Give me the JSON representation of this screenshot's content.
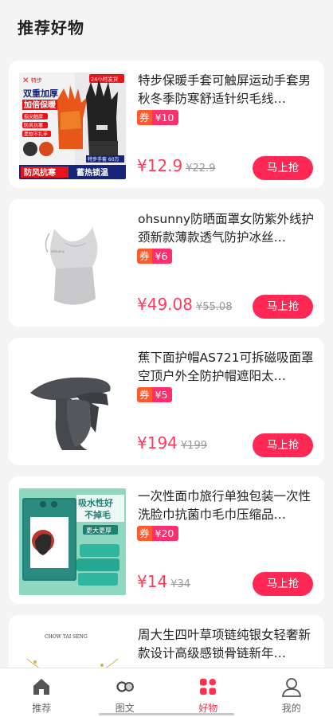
{
  "header": {
    "title": "推荐好物"
  },
  "products": [
    {
      "title": "特步保暖手套可触屏运动手套男秋冬季防寒舒适针织毛线…",
      "coupon_tag": "券",
      "coupon_value": "¥10",
      "price": "¥12.9",
      "original_price": "¥22.9",
      "buy_label": "马上抢",
      "image_text": {
        "brand": "特步",
        "badge": "24小时发货",
        "headline1": "双重加厚",
        "headline2": "加倍保暖",
        "feature1": "指尖触屏",
        "feature2": "防风抗寒",
        "feature3": "柔软不扎手",
        "sales": "特步手套 60万",
        "tag1": "防风抗寒",
        "tag2": "蓄热锁温"
      }
    },
    {
      "title": "ohsunny防晒面罩女防紫外线护颈新款薄款透气防护冰丝…",
      "coupon_tag": "券",
      "coupon_value": "¥6",
      "price": "¥49.08",
      "original_price": "¥55.08",
      "buy_label": "马上抢"
    },
    {
      "title": "蕉下面护帽AS721可拆磁吸面罩空顶户外全防护帽遮阳太…",
      "coupon_tag": "券",
      "coupon_value": "¥5",
      "price": "¥194",
      "original_price": "¥199",
      "buy_label": "马上抢"
    },
    {
      "title": "一次性面巾旅行单独包装一次性洗脸巾抗菌巾毛巾压缩品…",
      "coupon_tag": "券",
      "coupon_value": "¥20",
      "price": "¥14",
      "original_price": "¥34",
      "buy_label": "马上抢",
      "image_text": {
        "line1": "吸水性好",
        "line2": "不掉毛",
        "line3": "更大更厚"
      }
    },
    {
      "title": "周大生四叶草项链纯银女轻奢新款设计高级感锁骨链新年…",
      "image_text": {
        "brand": "CHOW TAI SENG"
      }
    }
  ],
  "tabbar": {
    "items": [
      {
        "label": "推荐",
        "icon": "home-icon"
      },
      {
        "label": "图文",
        "icon": "image-text-icon"
      },
      {
        "label": "好物",
        "icon": "goods-grid-icon",
        "active": true
      },
      {
        "label": "我的",
        "icon": "user-icon"
      }
    ]
  },
  "colors": {
    "accent": "#ff2f4e",
    "price": "#ff3b5c",
    "button": "#ff2855"
  }
}
